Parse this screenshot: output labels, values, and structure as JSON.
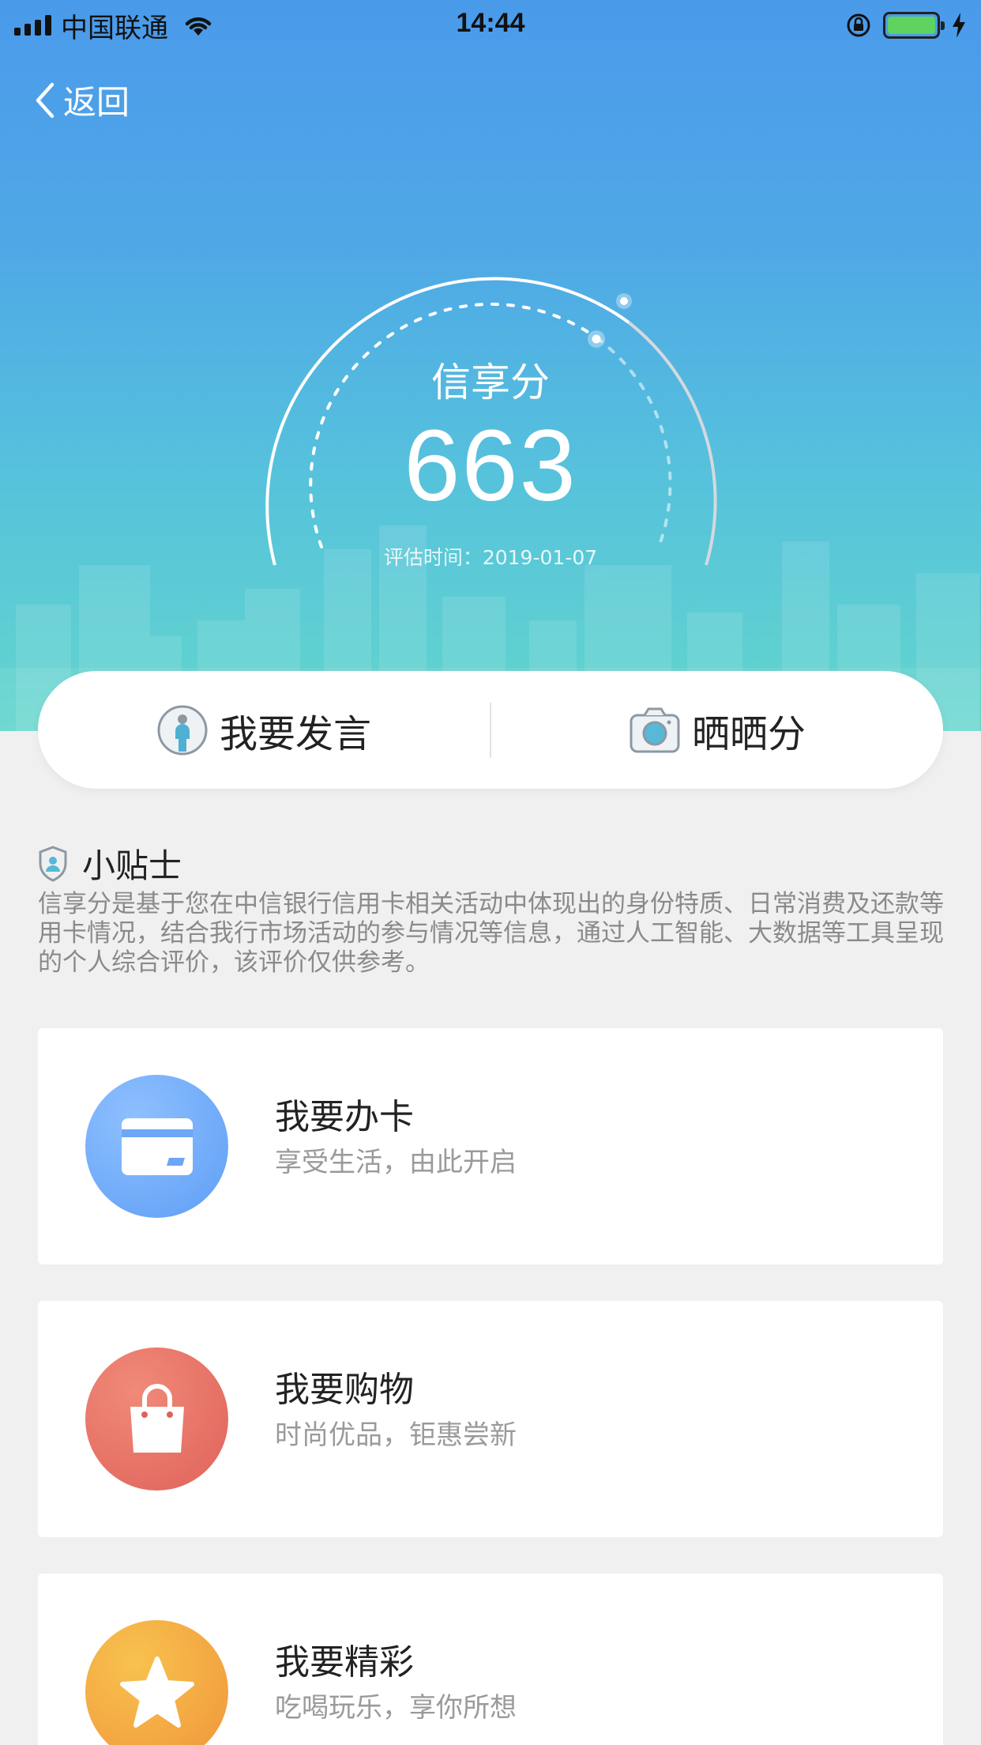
{
  "status_bar": {
    "carrier": "中国联通",
    "time": "14:44"
  },
  "nav": {
    "back_label": "返回"
  },
  "score": {
    "title": "信享分",
    "value": "663",
    "eval_date": "评估时间：2019-01-07"
  },
  "actions": [
    {
      "label": "我要发言",
      "icon": "microphone-person-icon"
    },
    {
      "label": "晒晒分",
      "icon": "camera-icon"
    }
  ],
  "tips": {
    "title": "小贴士",
    "text": "信享分是基于您在中信银行信用卡相关活动中体现出的身份特质、日常消费及还款等用卡情况，结合我行市场活动的参与情况等信息，通过人工智能、大数据等工具呈现的个人综合评价，该评价仅供参考。"
  },
  "cards": [
    {
      "title": "我要办卡",
      "subtitle": "享受生活，由此开启",
      "icon": "credit-card-icon",
      "color": "#5f9ef5"
    },
    {
      "title": "我要购物",
      "subtitle": "时尚优品，钜惠尝新",
      "icon": "shopping-bag-icon",
      "color": "#e86a5c"
    },
    {
      "title": "我要精彩",
      "subtitle": "吃喝玩乐，享你所想",
      "icon": "star-icon",
      "color": "#f2a23c"
    }
  ],
  "colors": {
    "hero_top": "#4a9aea",
    "hero_bottom": "#63d6cc",
    "page_bg": "#f0f0f0"
  }
}
